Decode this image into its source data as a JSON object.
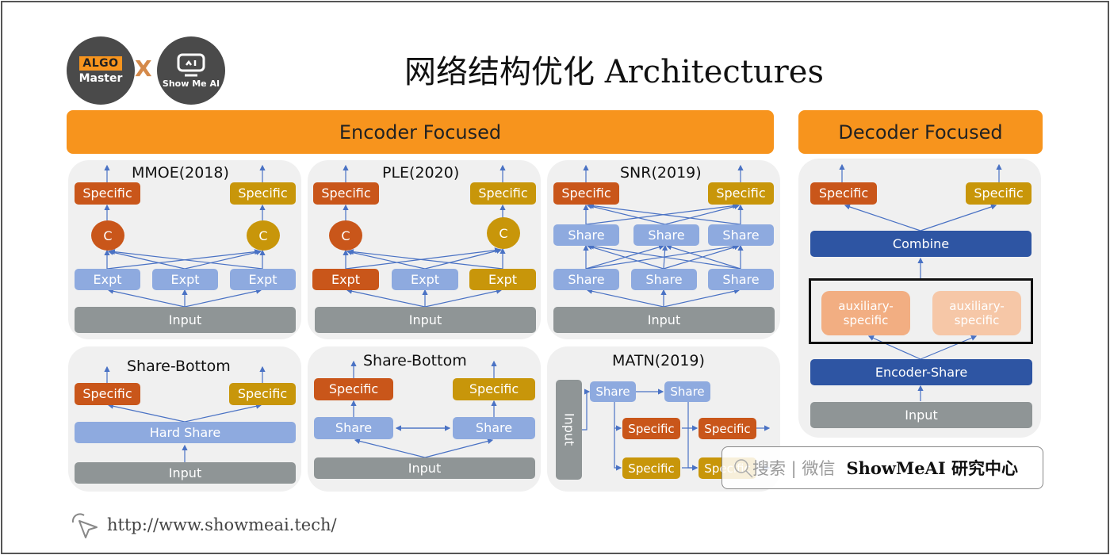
{
  "title": "网络结构优化 Architectures",
  "logos": {
    "algo_tag": "ALGO",
    "algo_name": "Master",
    "cross": "X",
    "showme": "Show Me AI"
  },
  "sections": {
    "encoder": "Encoder Focused",
    "decoder": "Decoder Focused"
  },
  "labels": {
    "specific": "Specific",
    "expt": "Expt",
    "input": "Input",
    "share": "Share",
    "c": "C",
    "hard_share": "Hard Share",
    "combine": "Combine",
    "encoder_share": "Encoder-Share",
    "aux": "auxiliary-specific"
  },
  "panels": {
    "mmoe": "MMOE(2018)",
    "ple": "PLE(2020)",
    "snr": "SNR(2019)",
    "sb1": "Share-Bottom",
    "sb2": "Share-Bottom",
    "matn": "MATN(2019)"
  },
  "colors": {
    "orange_header": "#f7941d",
    "specific_red": "#c9561a",
    "specific_yellow": "#c8960a",
    "share_blue": "#8eaadf",
    "input_gray": "#8f9596",
    "dark_blue": "#2e55a3",
    "arrow": "#4a72c4"
  },
  "watermark": {
    "search": "搜索 | 微信",
    "brand": "ShowMeAI 研究中心"
  },
  "footer": {
    "url": "http://www.showmeai.tech/"
  }
}
